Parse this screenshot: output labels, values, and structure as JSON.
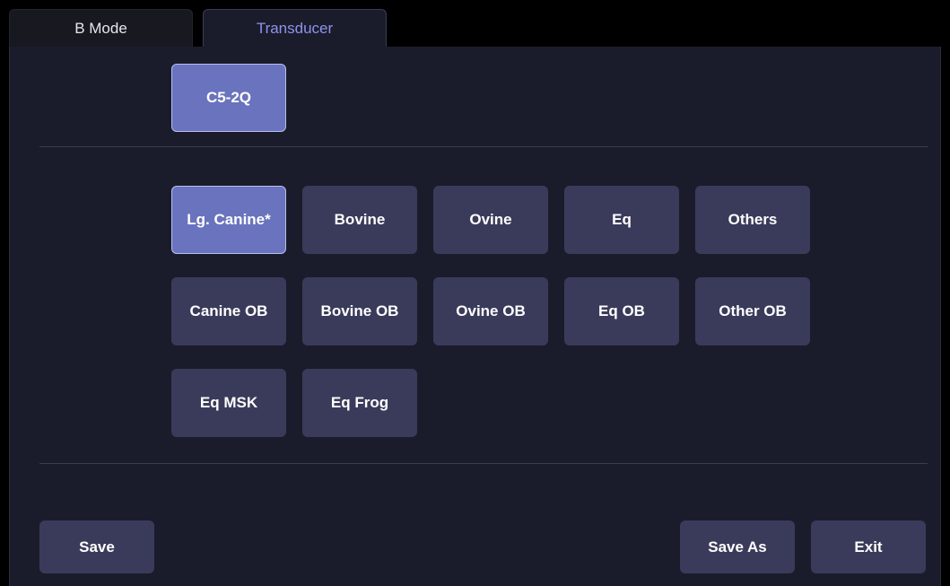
{
  "tabs": [
    {
      "label": "B Mode"
    },
    {
      "label": "Transducer"
    }
  ],
  "transducer": {
    "label": "C5-2Q"
  },
  "presets": [
    {
      "label": "Lg. Canine*"
    },
    {
      "label": "Bovine"
    },
    {
      "label": "Ovine"
    },
    {
      "label": "Eq"
    },
    {
      "label": "Others"
    },
    {
      "label": "Canine OB"
    },
    {
      "label": "Bovine OB"
    },
    {
      "label": "Ovine OB"
    },
    {
      "label": "Eq OB"
    },
    {
      "label": "Other OB"
    },
    {
      "label": "Eq MSK"
    },
    {
      "label": "Eq Frog"
    }
  ],
  "actions": {
    "save": "Save",
    "save_as": "Save As",
    "exit": "Exit"
  },
  "colors": {
    "panel_bg": "#1b1c2b",
    "button_bg": "#3a3b5a",
    "selected_bg": "#6a73bd",
    "active_tab_text": "#8d93ea"
  }
}
